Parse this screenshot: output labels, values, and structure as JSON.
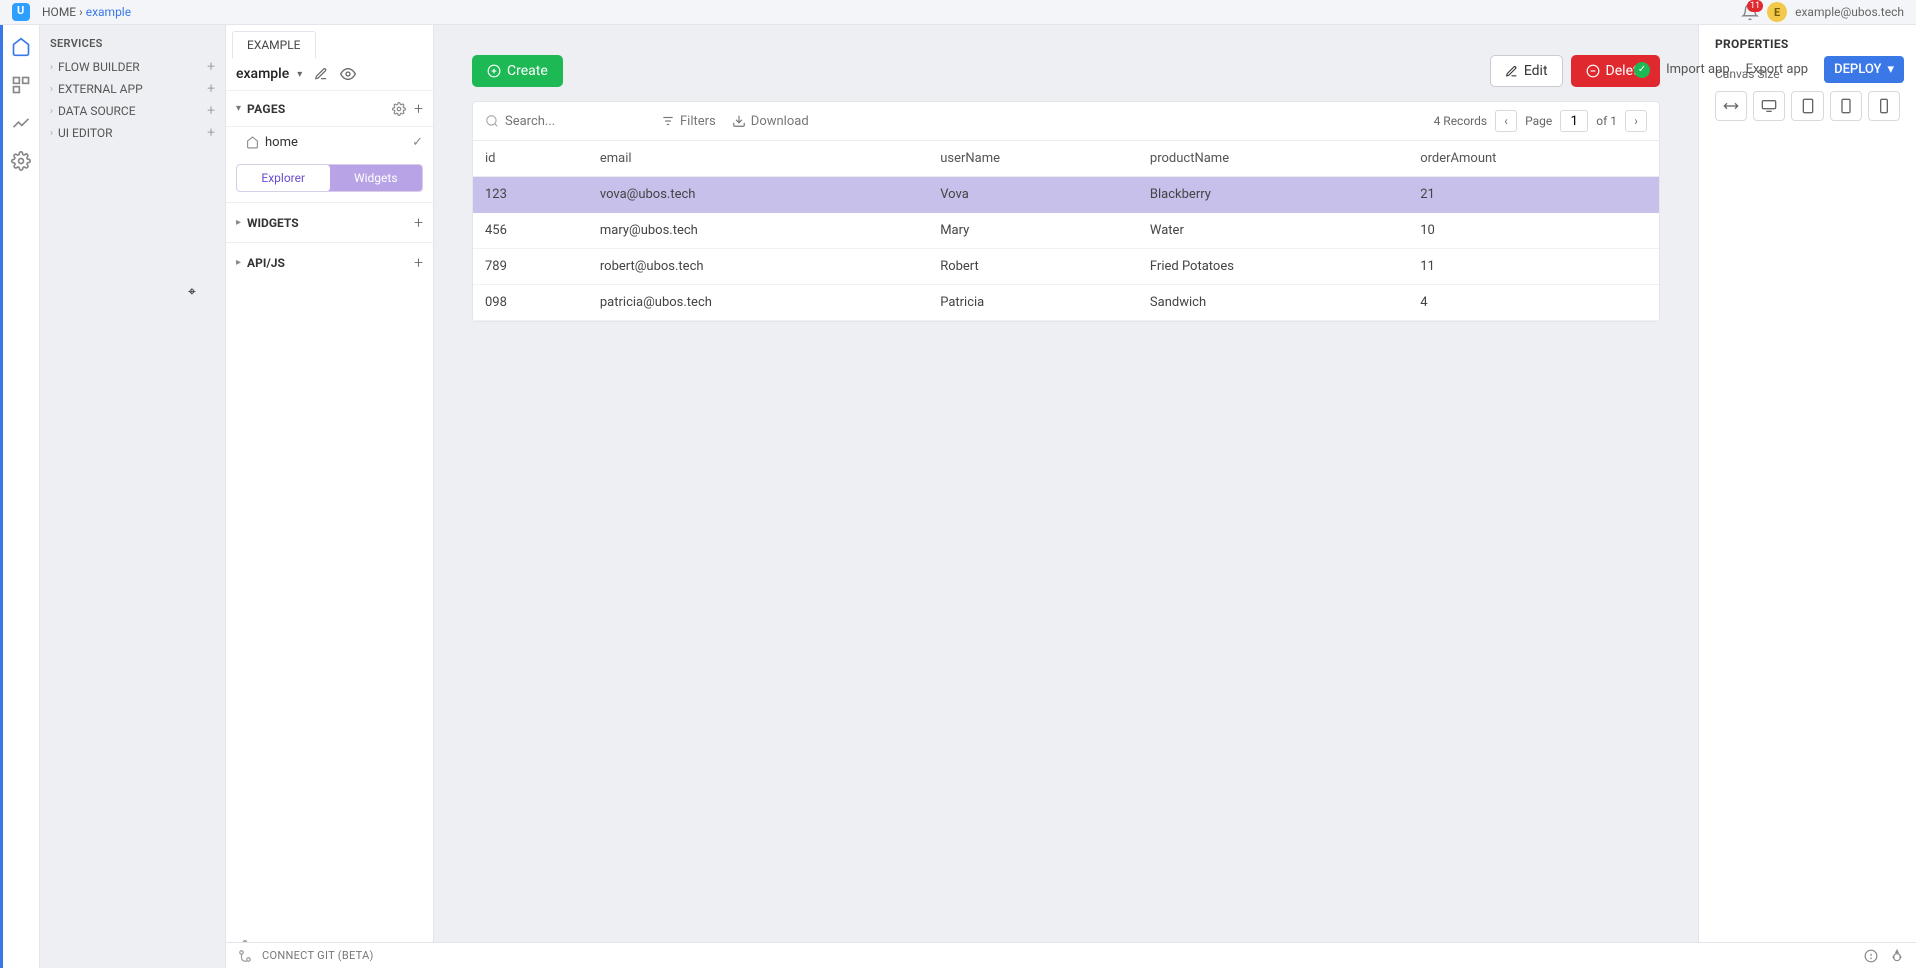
{
  "breadcrumb": {
    "home": "HOME",
    "sep": "›",
    "current": "example"
  },
  "notifications": {
    "count": "11"
  },
  "user": {
    "initial": "E",
    "email": "example@ubos.tech"
  },
  "services": {
    "header": "SERVICES",
    "items": [
      {
        "label": "FLOW BUILDER"
      },
      {
        "label": "EXTERNAL APP"
      },
      {
        "label": "DATA SOURCE"
      },
      {
        "label": "UI EDITOR"
      }
    ]
  },
  "editorNav": {
    "tab": "EXAMPLE",
    "selector": "example",
    "pages": {
      "title": "PAGES",
      "item": "home"
    },
    "modes": {
      "explorer": "Explorer",
      "widgets": "Widgets"
    },
    "widgets": "WIDGETS",
    "api": "API/JS"
  },
  "actionbar": {
    "import": "Import app",
    "export": "Export app",
    "deploy": "DEPLOY"
  },
  "canvas": {
    "buttons": {
      "create": "Create",
      "edit": "Edit",
      "delete": "Delete"
    },
    "search": {
      "placeholder": "Search..."
    },
    "filters": "Filters",
    "download": "Download",
    "records": "4 Records",
    "pageLabel": "Page",
    "pageCurrent": "1",
    "pageOf": "of 1",
    "columns": [
      "id",
      "email",
      "userName",
      "productName",
      "orderAmount"
    ],
    "rows": [
      {
        "id": "123",
        "email": "vova@ubos.tech",
        "userName": "Vova",
        "productName": "Blackberry",
        "orderAmount": "21",
        "selected": true
      },
      {
        "id": "456",
        "email": "mary@ubos.tech",
        "userName": "Mary",
        "productName": "Water",
        "orderAmount": "10"
      },
      {
        "id": "789",
        "email": "robert@ubos.tech",
        "userName": "Robert",
        "productName": "Fried Potatoes",
        "orderAmount": "11"
      },
      {
        "id": "098",
        "email": "patricia@ubos.tech",
        "userName": "Patricia",
        "productName": "Sandwich",
        "orderAmount": "4"
      }
    ]
  },
  "properties": {
    "title": "PROPERTIES",
    "canvasSize": "Canvas Size"
  },
  "bottombar": {
    "git": "CONNECT GIT (BETA)"
  }
}
